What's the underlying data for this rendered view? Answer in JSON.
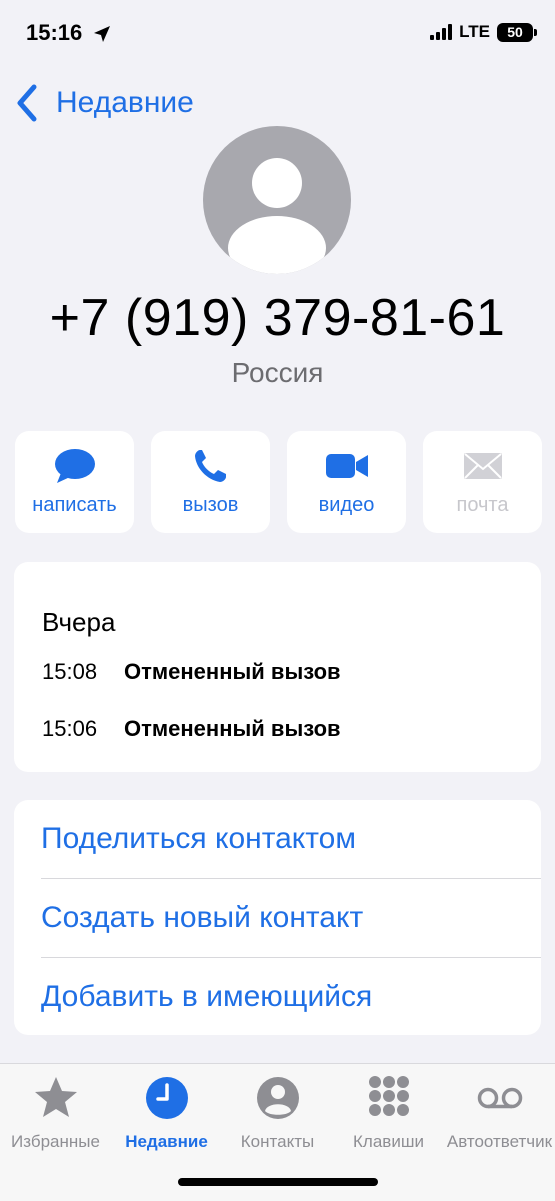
{
  "status_bar": {
    "time": "15:16",
    "network": "LTE",
    "battery": "50"
  },
  "nav": {
    "back_label": "Недавние"
  },
  "contact": {
    "phone": "+7 (919) 379-81-61",
    "country": "Россия"
  },
  "actions": [
    {
      "label": "написать",
      "icon": "message-icon",
      "enabled": true
    },
    {
      "label": "вызов",
      "icon": "phone-icon",
      "enabled": true
    },
    {
      "label": "видео",
      "icon": "video-icon",
      "enabled": true
    },
    {
      "label": "почта",
      "icon": "mail-icon",
      "enabled": false
    }
  ],
  "call_history": {
    "date": "Вчера",
    "calls": [
      {
        "time": "15:08",
        "status": "Отмененный вызов"
      },
      {
        "time": "15:06",
        "status": "Отмененный вызов"
      }
    ]
  },
  "options": [
    "Поделиться контактом",
    "Создать новый контакт",
    "Добавить в имеющийся"
  ],
  "tabs": [
    {
      "label": "Избранные",
      "icon": "star-icon",
      "active": false
    },
    {
      "label": "Недавние",
      "icon": "clock-icon",
      "active": true
    },
    {
      "label": "Контакты",
      "icon": "contacts-icon",
      "active": false
    },
    {
      "label": "Клавиши",
      "icon": "keypad-icon",
      "active": false
    },
    {
      "label": "Автоответчик",
      "icon": "voicemail-icon",
      "active": false
    }
  ],
  "colors": {
    "accent": "#1f6fe5",
    "background": "#f2f2f7",
    "secondary_text": "#6c6c70",
    "inactive": "#8e8e93"
  }
}
